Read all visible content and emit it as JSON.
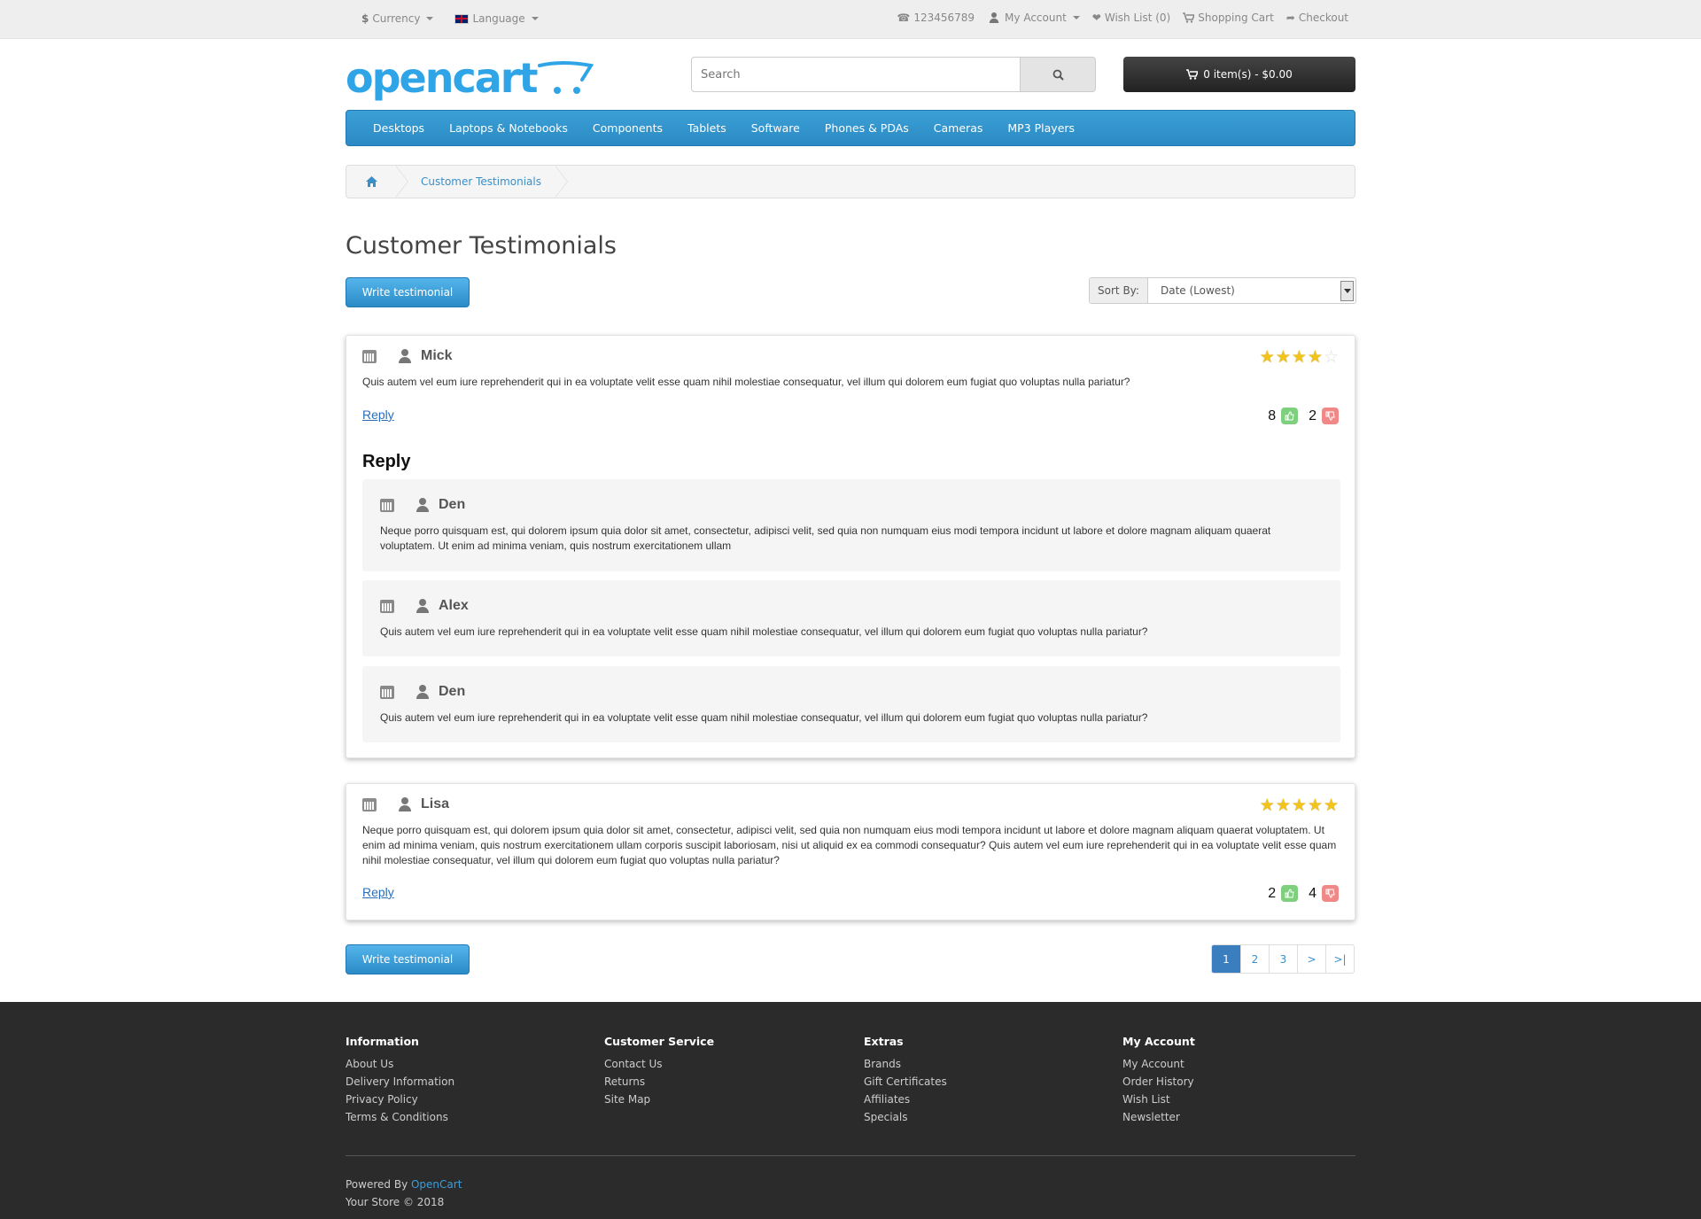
{
  "topbar": {
    "currency": "Currency",
    "language": "Language",
    "phone": "123456789",
    "my_account": "My Account",
    "wish_list": "Wish List (0)",
    "shopping_cart": "Shopping Cart",
    "checkout": "Checkout"
  },
  "header": {
    "logo_text": "opencart",
    "search_placeholder": "Search",
    "cart_label": "0 item(s) - $0.00"
  },
  "nav": {
    "items": [
      "Desktops",
      "Laptops & Notebooks",
      "Components",
      "Tablets",
      "Software",
      "Phones & PDAs",
      "Cameras",
      "MP3 Players"
    ]
  },
  "breadcrumb": {
    "current": "Customer Testimonials"
  },
  "page": {
    "title": "Customer Testimonials",
    "write_button": "Write testimonial",
    "sort_label": "Sort By:",
    "sort_value": "Date (Lowest)"
  },
  "testimonials": [
    {
      "name": "Mick",
      "rating": 4,
      "text": "Quis autem vel eum iure reprehenderit qui in ea voluptate velit esse quam nihil molestiae consequatur, vel illum qui dolorem eum fugiat quo voluptas nulla pariatur?",
      "reply_link": "Reply",
      "likes": "8",
      "dislikes": "2",
      "replies_heading": "Reply",
      "replies": [
        {
          "name": "Den",
          "text": "Neque porro quisquam est, qui dolorem ipsum quia dolor sit amet, consectetur, adipisci velit, sed quia non numquam eius modi tempora incidunt ut labore et dolore magnam aliquam quaerat voluptatem. Ut enim ad minima veniam, quis nostrum exercitationem ullam"
        },
        {
          "name": "Alex",
          "text": "Quis autem vel eum iure reprehenderit qui in ea voluptate velit esse quam nihil molestiae consequatur, vel illum qui dolorem eum fugiat quo voluptas nulla pariatur?"
        },
        {
          "name": "Den",
          "text": "Quis autem vel eum iure reprehenderit qui in ea voluptate velit esse quam nihil molestiae consequatur, vel illum qui dolorem eum fugiat quo voluptas nulla pariatur?"
        }
      ]
    },
    {
      "name": "Lisa",
      "rating": 5,
      "text": "Neque porro quisquam est, qui dolorem ipsum quia dolor sit amet, consectetur, adipisci velit, sed quia non numquam eius modi tempora incidunt ut labore et dolore magnam aliquam quaerat voluptatem. Ut enim ad minima veniam, quis nostrum exercitationem ullam corporis suscipit laboriosam, nisi ut aliquid ex ea commodi consequatur? Quis autem vel eum iure reprehenderit qui in ea voluptate velit esse quam nihil molestiae consequatur, vel illum qui dolorem eum fugiat quo voluptas nulla pariatur?",
      "reply_link": "Reply",
      "likes": "2",
      "dislikes": "4"
    }
  ],
  "pagination": [
    "1",
    "2",
    "3",
    ">",
    ">|"
  ],
  "footer": {
    "columns": [
      {
        "title": "Information",
        "links": [
          "About Us",
          "Delivery Information",
          "Privacy Policy",
          "Terms & Conditions"
        ]
      },
      {
        "title": "Customer Service",
        "links": [
          "Contact Us",
          "Returns",
          "Site Map"
        ]
      },
      {
        "title": "Extras",
        "links": [
          "Brands",
          "Gift Certificates",
          "Affiliates",
          "Specials"
        ]
      },
      {
        "title": "My Account",
        "links": [
          "My Account",
          "Order History",
          "Wish List",
          "Newsletter"
        ]
      }
    ],
    "powered_prefix": "Powered By ",
    "powered_link": "OpenCart",
    "copyright": "Your Store © 2018"
  },
  "colors": {
    "brand": "#2fa4e7",
    "nav": "#2c8ac4",
    "star": "#f2c318",
    "like": "#7ed07e",
    "dislike": "#f08888",
    "footer_bg": "#2b2b2b"
  }
}
